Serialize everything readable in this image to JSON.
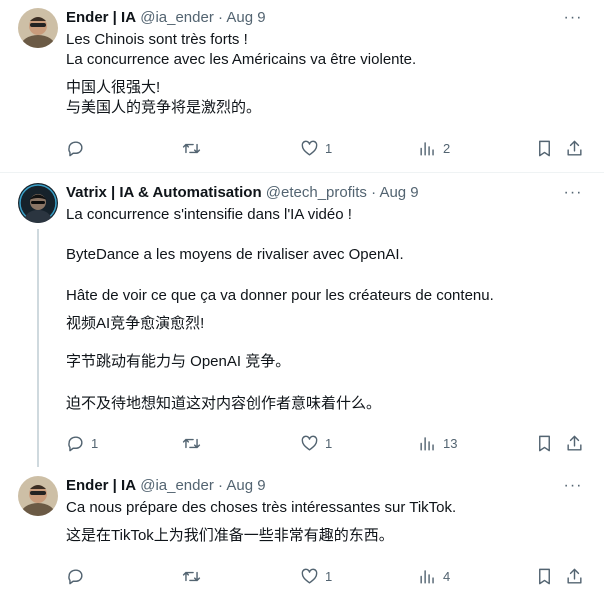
{
  "tweets": [
    {
      "name": "Ender | IA",
      "handle": "@ia_ender",
      "sep": "·",
      "date": "Aug 9",
      "lines": [
        "Les Chinois sont très forts !",
        "La concurrence avec les Américains va être violente.",
        "中国人很强大!",
        "与美国人的竞争将是激烈的。"
      ],
      "replies": "",
      "retweets": "",
      "likes": "1",
      "views": "2"
    },
    {
      "name": "Vatrix | IA & Automatisation",
      "handle": "@etech_profits",
      "sep": "·",
      "date": "Aug 9",
      "lines": [
        "La concurrence s'intensifie dans l'IA vidéo !",
        "ByteDance a les moyens de rivaliser avec OpenAI.",
        "Hâte de voir ce que ça va donner pour les créateurs de contenu.",
        "视频AI竞争愈演愈烈!",
        "字节跳动有能力与 OpenAI 竞争。",
        "迫不及待地想知道这对内容创作者意味着什么。"
      ],
      "replies": "1",
      "retweets": "",
      "likes": "1",
      "views": "13"
    },
    {
      "name": "Ender | IA",
      "handle": "@ia_ender",
      "sep": "·",
      "date": "Aug 9",
      "lines": [
        "Ca nous prépare des choses très intéressantes sur TikTok.",
        "这是在TikTok上为我们准备一些非常有趣的东西。"
      ],
      "replies": "",
      "retweets": "",
      "likes": "1",
      "views": "4"
    }
  ],
  "more_glyph": "···",
  "icons": {
    "reply": "reply-icon",
    "retweet": "retweet-icon",
    "like": "heart-icon",
    "views": "views-icon",
    "bookmark": "bookmark-icon",
    "share": "share-icon"
  },
  "colors": {
    "text": "#0f1419",
    "secondary": "#536471",
    "thread_line": "#cfd9de",
    "divider": "#eff3f4"
  }
}
